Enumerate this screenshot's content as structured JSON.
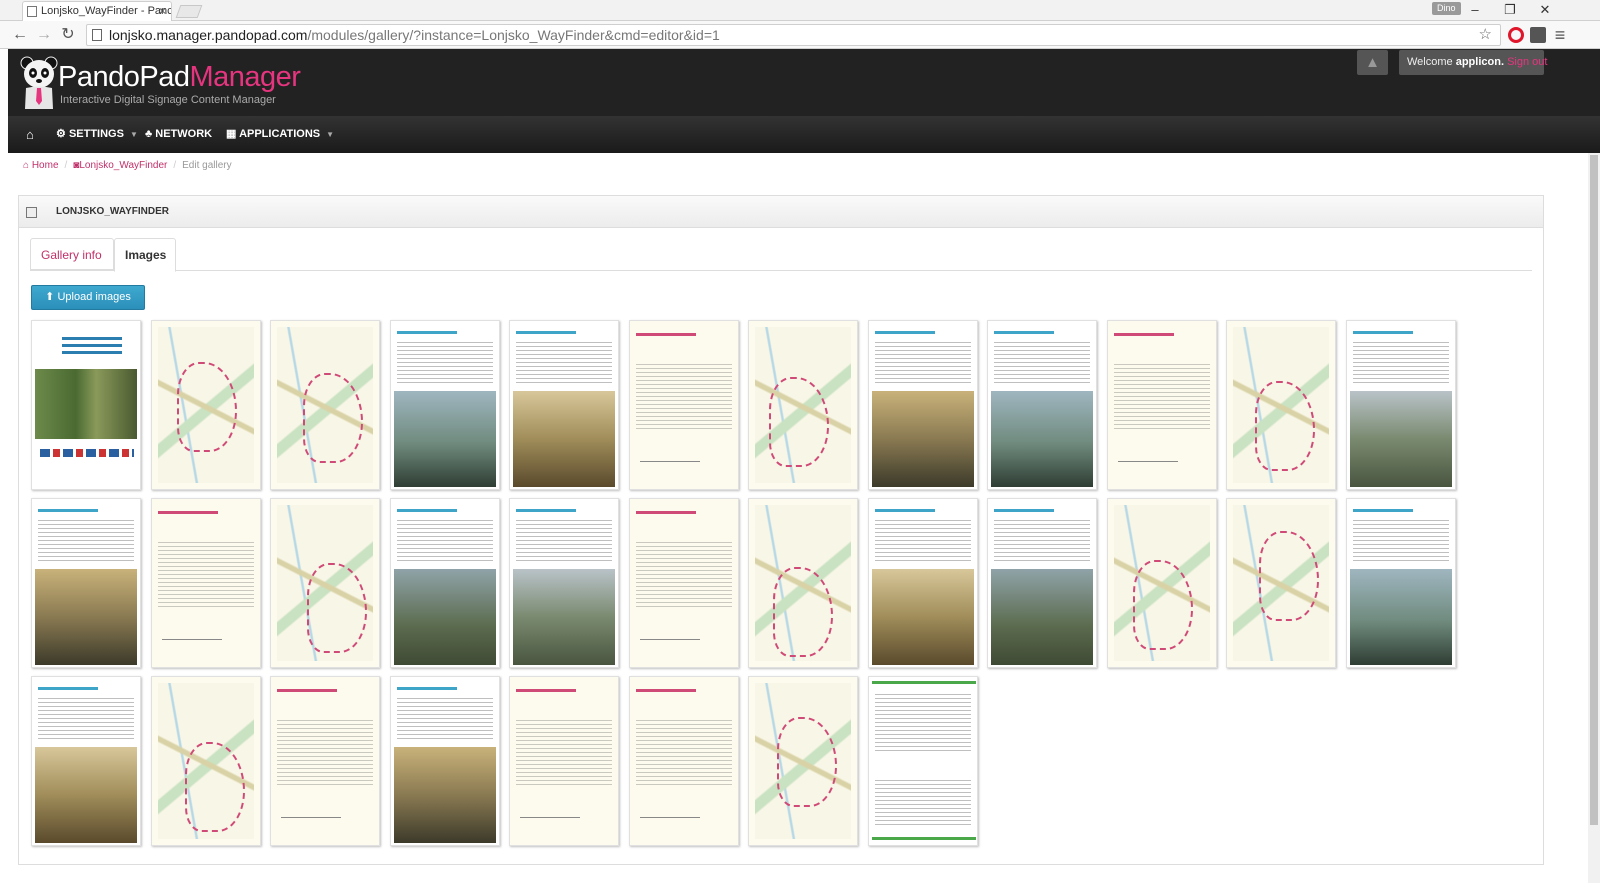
{
  "browser": {
    "tab_title": "Lonjsko_WayFinder - Panc",
    "tab_close": "×",
    "profile_name": "Dino",
    "url_domain": "lonjsko.manager.pandopad.com",
    "url_path": "/modules/gallery/?instance=Lonjsko_WayFinder&cmd=editor&id=1",
    "back_glyph": "←",
    "forward_glyph": "→",
    "reload_glyph": "↻",
    "star_glyph": "☆",
    "menu_glyph": "≡",
    "minimize_glyph": "–",
    "maximize_glyph": "❐",
    "close_glyph": "✕"
  },
  "header": {
    "brand_pando": "PandoPad",
    "brand_manager": "Manager",
    "tagline": "Interactive Digital Signage Content Manager",
    "alert_glyph": "▲",
    "welcome_prefix": "Welcome",
    "welcome_user": "applicon.",
    "sign_out": "Sign out",
    "brand_accent": "#e6357f"
  },
  "nav": {
    "home_glyph": "⌂",
    "settings": "SETTINGS",
    "network": "NETWORK",
    "applications": "APPLICATIONS",
    "caret": "▼"
  },
  "breadcrumb": {
    "home": "Home",
    "instance": "Lonjsko_WayFinder",
    "current": "Edit gallery",
    "separator": "/"
  },
  "box": {
    "title": "LONJSKO_WAYFINDER",
    "tab_info": "Gallery info",
    "tab_images": "Images",
    "upload_label": "Upload images"
  }
}
